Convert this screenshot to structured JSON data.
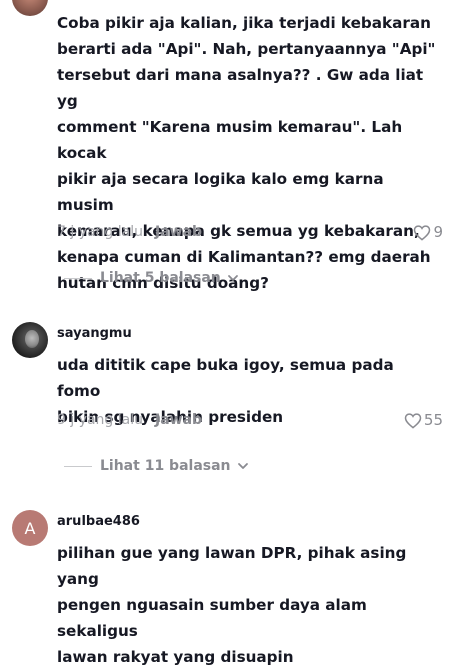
{
  "comments": [
    {
      "username": "",
      "text": "Coba pikir aja kalian, jika terjadi kebakaran\nberarti ada \"Api\". Nah, pertanyaannya \"Api\"\ntersebut dari mana asalnya?? . Gw ada liat yg\ncomment \"Karena musim kemarau\". Lah kocak\npikir aja secara logika kalo emg karna musim\nkemarau, kenapa gk semua yg kebakaran,\nkenapa cuman di Kalimantan?? emg daerah\nhutan cmn disitu doang?",
      "time": "7 j yang lalu",
      "reply_label": "Jawab",
      "likes": "9",
      "view_replies": "Lihat 5 balasan"
    },
    {
      "username": "sayangmu",
      "text": "uda dititik cape buka igoy, semua pada fomo\nbikin sg nyalahin presiden",
      "time": "9 j yang lalu",
      "reply_label": "Jawab",
      "likes": "55",
      "view_replies": "Lihat 11 balasan"
    },
    {
      "username": "arulbae486",
      "avatar_letter": "A",
      "text": "pilihan gue yang lawan DPR, pihak asing yang\npengen nguasain sumber daya alam sekaligus\nlawan rakyat yang disuapin"
    }
  ],
  "colors": {
    "text": "#161823",
    "muted": "#8a8b91",
    "avatar_letter_bg": "#b87a74"
  },
  "icons": [
    "heart-outline-icon",
    "chevron-down-icon"
  ]
}
